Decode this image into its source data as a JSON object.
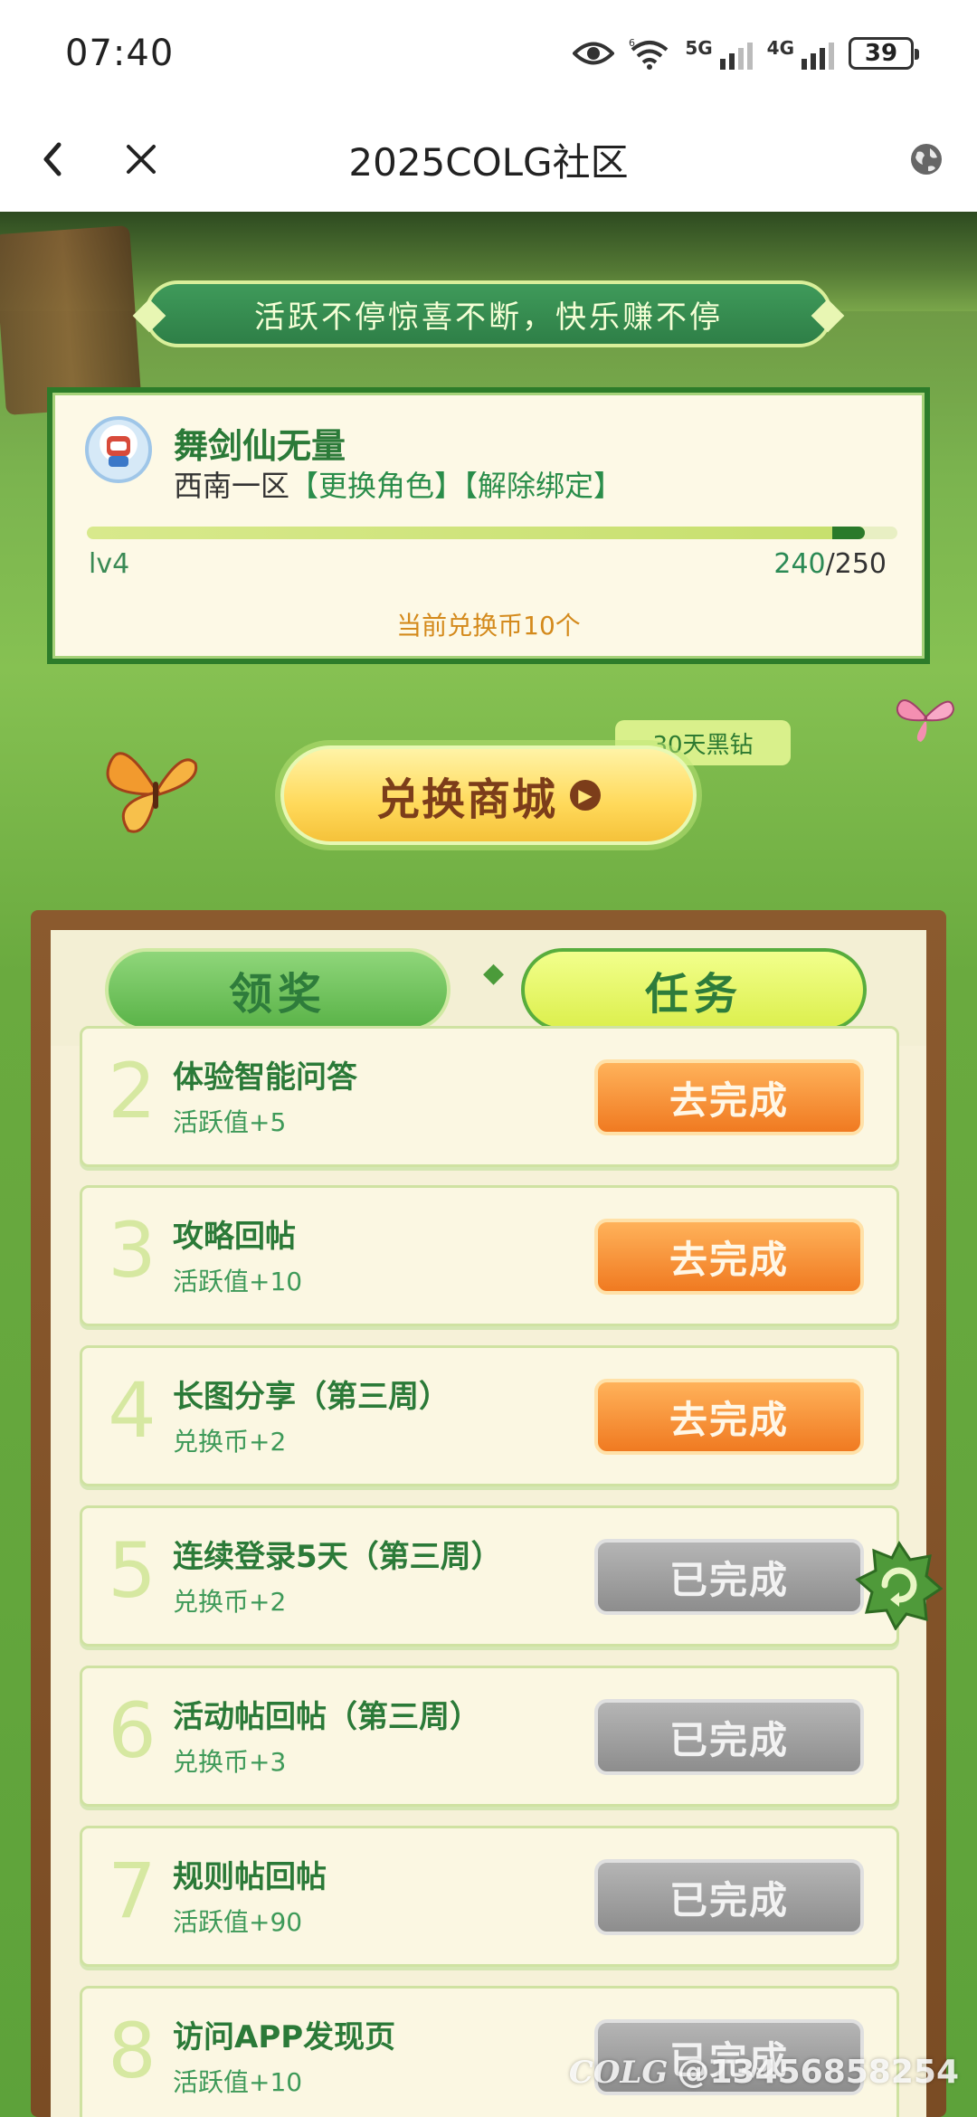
{
  "status_bar": {
    "time": "07:40",
    "network_1": "5G",
    "network_2": "4G",
    "wifi_label": "6",
    "battery": "39"
  },
  "nav": {
    "title": "2025COLG社区",
    "back_icon": "chevron-left-icon",
    "close_icon": "close-icon",
    "globe_icon": "globe-icon"
  },
  "hero": {
    "slogan": "活跃不停惊喜不断，快乐赚不停"
  },
  "profile": {
    "name": "舞剑仙无量",
    "server": "西南一区",
    "change_role": "【更换角色】",
    "unbind": "【解除绑定】",
    "level": "lv4",
    "exp_current": "240",
    "exp_sep_total": "/250",
    "progress": 0.96,
    "coins": "当前兑换币10个"
  },
  "shop": {
    "badge": "30天黑钻",
    "label": "兑换商城"
  },
  "tabs": {
    "reward": "领奖",
    "tasks": "任务"
  },
  "tasks": [
    {
      "num": "2",
      "title": "体验智能问答",
      "reward": "活跃值+5",
      "button": "去完成",
      "state": "todo"
    },
    {
      "num": "3",
      "title": "攻略回帖",
      "reward": "活跃值+10",
      "button": "去完成",
      "state": "todo"
    },
    {
      "num": "4",
      "title": "长图分享（第三周）",
      "reward": "兑换币+2",
      "button": "去完成",
      "state": "todo"
    },
    {
      "num": "5",
      "title": "连续登录5天（第三周）",
      "reward": "兑换币+2",
      "button": "已完成",
      "state": "done"
    },
    {
      "num": "6",
      "title": "活动帖回帖（第三周）",
      "reward": "兑换币+3",
      "button": "已完成",
      "state": "done"
    },
    {
      "num": "7",
      "title": "规则帖回帖",
      "reward": "活跃值+90",
      "button": "已完成",
      "state": "done"
    },
    {
      "num": "8",
      "title": "访问APP发现页",
      "reward": "活跃值+10",
      "button": "已完成",
      "state": "done"
    }
  ],
  "watermark": {
    "logo": "COLG",
    "user": "@13456858254"
  },
  "colors": {
    "brand_green": "#2b7a38",
    "todo_orange": "#f07a21",
    "done_gray": "#8d8d8d",
    "coin_orange": "#d48a1c"
  }
}
